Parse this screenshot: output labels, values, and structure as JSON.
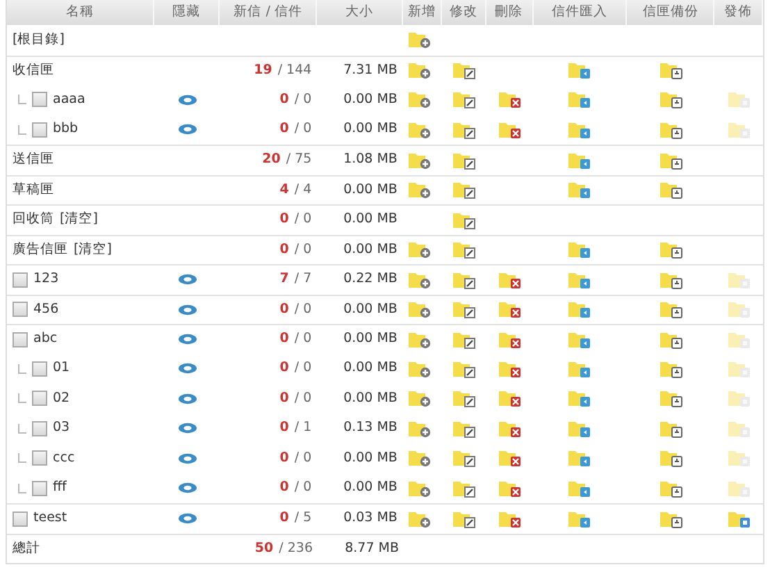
{
  "columns": [
    "名稱",
    "隱藏",
    "新信 / 信件",
    "大小",
    "新增",
    "修改",
    "刪除",
    "信件匯入",
    "信匣備份",
    "發佈"
  ],
  "folders": [
    {
      "kind": "root",
      "name": "[根目錄]",
      "actions": {
        "add": true,
        "edit": false,
        "delete": false,
        "import": false,
        "backup": false
      }
    },
    {
      "kind": "system",
      "name": "收信匣",
      "new": "19",
      "total": "/ 144",
      "size": "7.31 MB",
      "actions": {
        "add": true,
        "edit": true,
        "delete": false,
        "import": true,
        "backup": true
      },
      "children": [
        {
          "kind": "user",
          "name": "aaaa",
          "checked": false,
          "new": "0",
          "total": "/ 0",
          "size": "0.00 MB",
          "actions": {
            "add": true,
            "edit": true,
            "delete": true,
            "import": true,
            "backup": true
          },
          "published": false
        },
        {
          "kind": "user",
          "name": "bbb",
          "checked": false,
          "new": "0",
          "total": "/ 0",
          "size": "0.00 MB",
          "actions": {
            "add": true,
            "edit": true,
            "delete": true,
            "import": true,
            "backup": true
          },
          "published": false
        }
      ]
    },
    {
      "kind": "system",
      "name": "送信匣",
      "new": "20",
      "total": "/ 75",
      "size": "1.08 MB",
      "actions": {
        "add": true,
        "edit": true,
        "delete": false,
        "import": true,
        "backup": true
      }
    },
    {
      "kind": "system",
      "name": "草稿匣",
      "new": "4",
      "total": "/ 4",
      "size": "0.00 MB",
      "actions": {
        "add": true,
        "edit": true,
        "delete": false,
        "import": true,
        "backup": true
      }
    },
    {
      "kind": "system",
      "name": "回收筒",
      "empty_link": "[清空]",
      "new": "0",
      "total": "/ 0",
      "size": "0.00 MB",
      "actions": {
        "add": false,
        "edit": true,
        "delete": false,
        "import": false,
        "backup": false
      }
    },
    {
      "kind": "system",
      "name": "廣告信匣",
      "empty_link": "[清空]",
      "new": "0",
      "total": "/ 0",
      "size": "0.00 MB",
      "actions": {
        "add": true,
        "edit": true,
        "delete": false,
        "import": true,
        "backup": true
      }
    },
    {
      "kind": "user",
      "name": "123",
      "checked": false,
      "new": "7",
      "total": "/ 7",
      "size": "0.22 MB",
      "actions": {
        "add": true,
        "edit": true,
        "delete": true,
        "import": true,
        "backup": true
      },
      "published": false
    },
    {
      "kind": "user",
      "name": "456",
      "checked": false,
      "new": "0",
      "total": "/ 0",
      "size": "0.00 MB",
      "actions": {
        "add": true,
        "edit": true,
        "delete": true,
        "import": true,
        "backup": true
      },
      "published": false
    },
    {
      "kind": "user",
      "name": "abc",
      "checked": false,
      "new": "0",
      "total": "/ 0",
      "size": "0.00 MB",
      "actions": {
        "add": true,
        "edit": true,
        "delete": true,
        "import": true,
        "backup": true
      },
      "published": false,
      "children": [
        {
          "kind": "user",
          "name": "01",
          "checked": false,
          "new": "0",
          "total": "/ 0",
          "size": "0.00 MB",
          "actions": {
            "add": true,
            "edit": true,
            "delete": true,
            "import": true,
            "backup": true
          },
          "published": false
        },
        {
          "kind": "user",
          "name": "02",
          "checked": false,
          "new": "0",
          "total": "/ 0",
          "size": "0.00 MB",
          "actions": {
            "add": true,
            "edit": true,
            "delete": true,
            "import": true,
            "backup": true
          },
          "published": false
        },
        {
          "kind": "user",
          "name": "03",
          "checked": false,
          "new": "0",
          "total": "/ 1",
          "size": "0.13 MB",
          "actions": {
            "add": true,
            "edit": true,
            "delete": true,
            "import": true,
            "backup": true
          },
          "published": false
        },
        {
          "kind": "user",
          "name": "ccc",
          "checked": false,
          "new": "0",
          "total": "/ 0",
          "size": "0.00 MB",
          "actions": {
            "add": true,
            "edit": true,
            "delete": true,
            "import": true,
            "backup": true
          },
          "published": false
        },
        {
          "kind": "user",
          "name": "fff",
          "checked": false,
          "new": "0",
          "total": "/ 0",
          "size": "0.00 MB",
          "actions": {
            "add": true,
            "edit": true,
            "delete": true,
            "import": true,
            "backup": true
          },
          "published": false
        }
      ]
    },
    {
      "kind": "user",
      "name": "teest",
      "checked": false,
      "new": "0",
      "total": "/ 5",
      "size": "0.03 MB",
      "actions": {
        "add": true,
        "edit": true,
        "delete": true,
        "import": true,
        "backup": true
      },
      "published": true
    }
  ],
  "total": {
    "label": "總計",
    "new": "50",
    "total": "/ 236",
    "size": "8.77 MB"
  }
}
